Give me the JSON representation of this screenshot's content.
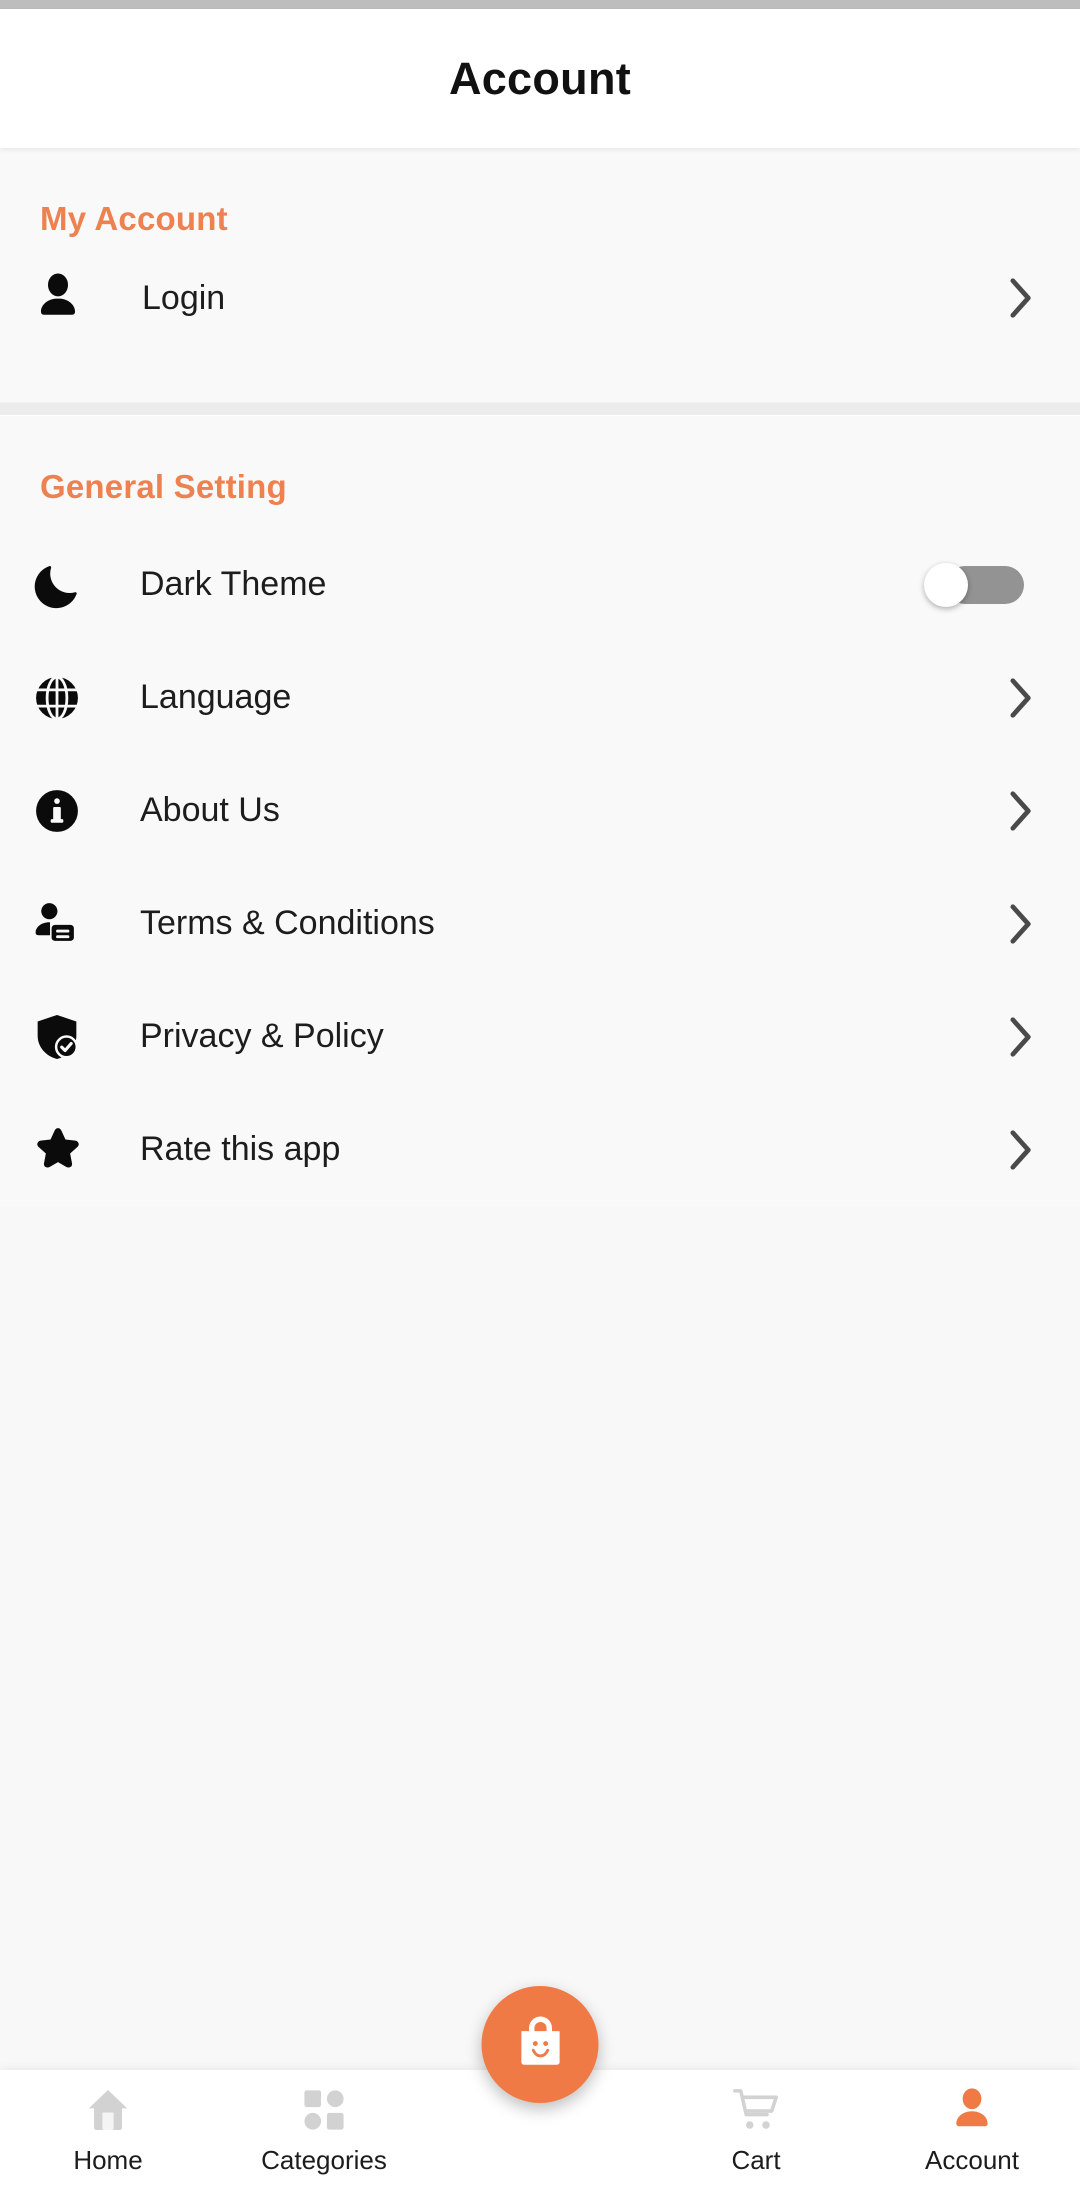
{
  "header": {
    "title": "Account"
  },
  "colors": {
    "accent": "#ee8150",
    "fab": "#f07a46",
    "text": "#1d1d1d",
    "inactive_nav": "#d0d0d0",
    "toggle_track": "#939393",
    "status_bar": "#bdbdbd"
  },
  "sections": [
    {
      "title": "My Account",
      "rows": [
        {
          "label": "Login",
          "icon": "person-icon",
          "accessory": "chevron"
        }
      ]
    },
    {
      "title": "General Setting",
      "rows": [
        {
          "label": "Dark Theme",
          "icon": "moon-icon",
          "accessory": "toggle",
          "toggle_on": false
        },
        {
          "label": "Language",
          "icon": "globe-icon",
          "accessory": "chevron"
        },
        {
          "label": "About Us",
          "icon": "info-icon",
          "accessory": "chevron"
        },
        {
          "label": "Terms & Conditions",
          "icon": "terms-icon",
          "accessory": "chevron"
        },
        {
          "label": "Privacy & Policy",
          "icon": "shield-check-icon",
          "accessory": "chevron"
        },
        {
          "label": "Rate this app",
          "icon": "star-icon",
          "accessory": "chevron"
        }
      ]
    }
  ],
  "bottom_nav": {
    "items": [
      {
        "label": "Home",
        "icon": "home-icon",
        "active": false
      },
      {
        "label": "Categories",
        "icon": "grid-icon",
        "active": false
      },
      {
        "label": "Cart",
        "icon": "cart-icon",
        "active": false
      },
      {
        "label": "Account",
        "icon": "person-icon",
        "active": true
      }
    ],
    "fab": {
      "icon": "shopping-bag-smile-icon"
    }
  }
}
